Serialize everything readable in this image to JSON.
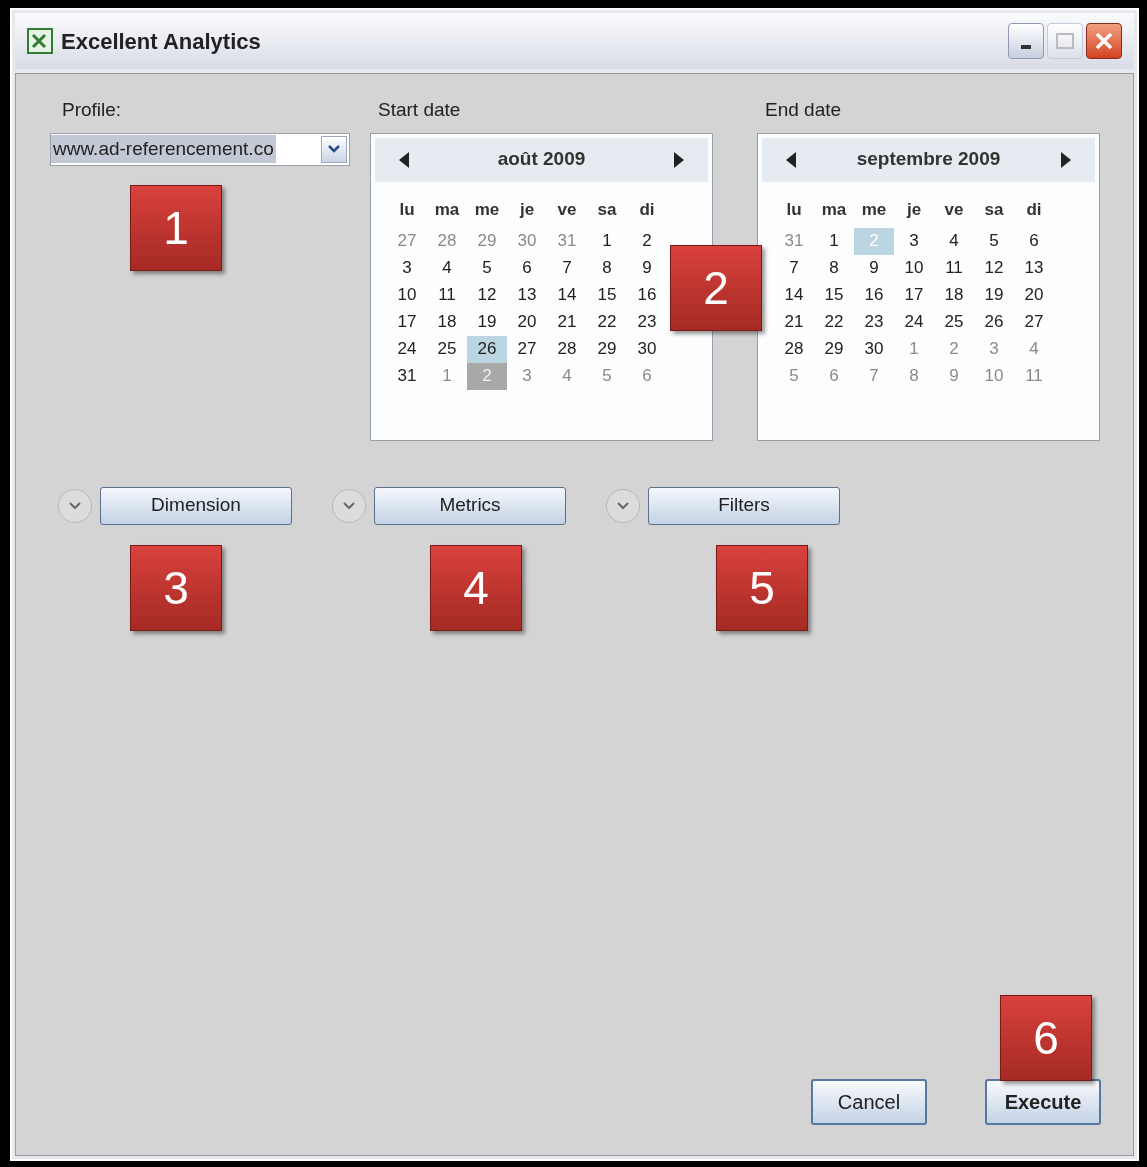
{
  "window": {
    "title": "Excellent Analytics"
  },
  "profile": {
    "label": "Profile:",
    "value": "www.ad-referencement.co"
  },
  "calendars": [
    {
      "label": "Start date",
      "month": "août 2009",
      "weekdays": [
        "lu",
        "ma",
        "me",
        "je",
        "ve",
        "sa",
        "di"
      ],
      "weeks": [
        [
          {
            "day": "27",
            "in_month": false,
            "today": false,
            "selected": false
          },
          {
            "day": "28",
            "in_month": false,
            "today": false,
            "selected": false
          },
          {
            "day": "29",
            "in_month": false,
            "today": false,
            "selected": false
          },
          {
            "day": "30",
            "in_month": false,
            "today": false,
            "selected": false
          },
          {
            "day": "31",
            "in_month": false,
            "today": false,
            "selected": false
          },
          {
            "day": "1",
            "in_month": true,
            "today": false,
            "selected": false
          },
          {
            "day": "2",
            "in_month": true,
            "today": false,
            "selected": false
          }
        ],
        [
          {
            "day": "3",
            "in_month": true,
            "today": false,
            "selected": false
          },
          {
            "day": "4",
            "in_month": true,
            "today": false,
            "selected": false
          },
          {
            "day": "5",
            "in_month": true,
            "today": false,
            "selected": false
          },
          {
            "day": "6",
            "in_month": true,
            "today": false,
            "selected": false
          },
          {
            "day": "7",
            "in_month": true,
            "today": false,
            "selected": false
          },
          {
            "day": "8",
            "in_month": true,
            "today": false,
            "selected": false
          },
          {
            "day": "9",
            "in_month": true,
            "today": false,
            "selected": false
          }
        ],
        [
          {
            "day": "10",
            "in_month": true,
            "today": false,
            "selected": false
          },
          {
            "day": "11",
            "in_month": true,
            "today": false,
            "selected": false
          },
          {
            "day": "12",
            "in_month": true,
            "today": false,
            "selected": false
          },
          {
            "day": "13",
            "in_month": true,
            "today": false,
            "selected": false
          },
          {
            "day": "14",
            "in_month": true,
            "today": false,
            "selected": false
          },
          {
            "day": "15",
            "in_month": true,
            "today": false,
            "selected": false
          },
          {
            "day": "16",
            "in_month": true,
            "today": false,
            "selected": false
          }
        ],
        [
          {
            "day": "17",
            "in_month": true,
            "today": false,
            "selected": false
          },
          {
            "day": "18",
            "in_month": true,
            "today": false,
            "selected": false
          },
          {
            "day": "19",
            "in_month": true,
            "today": false,
            "selected": false
          },
          {
            "day": "20",
            "in_month": true,
            "today": false,
            "selected": false
          },
          {
            "day": "21",
            "in_month": true,
            "today": false,
            "selected": false
          },
          {
            "day": "22",
            "in_month": true,
            "today": false,
            "selected": false
          },
          {
            "day": "23",
            "in_month": true,
            "today": false,
            "selected": false
          }
        ],
        [
          {
            "day": "24",
            "in_month": true,
            "today": false,
            "selected": false
          },
          {
            "day": "25",
            "in_month": true,
            "today": false,
            "selected": false
          },
          {
            "day": "26",
            "in_month": true,
            "today": false,
            "selected": true
          },
          {
            "day": "27",
            "in_month": true,
            "today": false,
            "selected": false
          },
          {
            "day": "28",
            "in_month": true,
            "today": false,
            "selected": false
          },
          {
            "day": "29",
            "in_month": true,
            "today": false,
            "selected": false
          },
          {
            "day": "30",
            "in_month": true,
            "today": false,
            "selected": false
          }
        ],
        [
          {
            "day": "31",
            "in_month": true,
            "today": false,
            "selected": false
          },
          {
            "day": "1",
            "in_month": false,
            "today": false,
            "selected": false
          },
          {
            "day": "2",
            "in_month": false,
            "today": true,
            "selected": false
          },
          {
            "day": "3",
            "in_month": false,
            "today": false,
            "selected": false
          },
          {
            "day": "4",
            "in_month": false,
            "today": false,
            "selected": false
          },
          {
            "day": "5",
            "in_month": false,
            "today": false,
            "selected": false
          },
          {
            "day": "6",
            "in_month": false,
            "today": false,
            "selected": false
          }
        ]
      ]
    },
    {
      "label": "End date",
      "month": "septembre 2009",
      "weekdays": [
        "lu",
        "ma",
        "me",
        "je",
        "ve",
        "sa",
        "di"
      ],
      "weeks": [
        [
          {
            "day": "31",
            "in_month": false,
            "today": false,
            "selected": false
          },
          {
            "day": "1",
            "in_month": true,
            "today": false,
            "selected": false
          },
          {
            "day": "2",
            "in_month": true,
            "today": true,
            "selected": true
          },
          {
            "day": "3",
            "in_month": true,
            "today": false,
            "selected": false
          },
          {
            "day": "4",
            "in_month": true,
            "today": false,
            "selected": false
          },
          {
            "day": "5",
            "in_month": true,
            "today": false,
            "selected": false
          },
          {
            "day": "6",
            "in_month": true,
            "today": false,
            "selected": false
          }
        ],
        [
          {
            "day": "7",
            "in_month": true,
            "today": false,
            "selected": false
          },
          {
            "day": "8",
            "in_month": true,
            "today": false,
            "selected": false
          },
          {
            "day": "9",
            "in_month": true,
            "today": false,
            "selected": false
          },
          {
            "day": "10",
            "in_month": true,
            "today": false,
            "selected": false
          },
          {
            "day": "11",
            "in_month": true,
            "today": false,
            "selected": false
          },
          {
            "day": "12",
            "in_month": true,
            "today": false,
            "selected": false
          },
          {
            "day": "13",
            "in_month": true,
            "today": false,
            "selected": false
          }
        ],
        [
          {
            "day": "14",
            "in_month": true,
            "today": false,
            "selected": false
          },
          {
            "day": "15",
            "in_month": true,
            "today": false,
            "selected": false
          },
          {
            "day": "16",
            "in_month": true,
            "today": false,
            "selected": false
          },
          {
            "day": "17",
            "in_month": true,
            "today": false,
            "selected": false
          },
          {
            "day": "18",
            "in_month": true,
            "today": false,
            "selected": false
          },
          {
            "day": "19",
            "in_month": true,
            "today": false,
            "selected": false
          },
          {
            "day": "20",
            "in_month": true,
            "today": false,
            "selected": false
          }
        ],
        [
          {
            "day": "21",
            "in_month": true,
            "today": false,
            "selected": false
          },
          {
            "day": "22",
            "in_month": true,
            "today": false,
            "selected": false
          },
          {
            "day": "23",
            "in_month": true,
            "today": false,
            "selected": false
          },
          {
            "day": "24",
            "in_month": true,
            "today": false,
            "selected": false
          },
          {
            "day": "25",
            "in_month": true,
            "today": false,
            "selected": false
          },
          {
            "day": "26",
            "in_month": true,
            "today": false,
            "selected": false
          },
          {
            "day": "27",
            "in_month": true,
            "today": false,
            "selected": false
          }
        ],
        [
          {
            "day": "28",
            "in_month": true,
            "today": false,
            "selected": false
          },
          {
            "day": "29",
            "in_month": true,
            "today": false,
            "selected": false
          },
          {
            "day": "30",
            "in_month": true,
            "today": false,
            "selected": false
          },
          {
            "day": "1",
            "in_month": false,
            "today": false,
            "selected": false
          },
          {
            "day": "2",
            "in_month": false,
            "today": false,
            "selected": false
          },
          {
            "day": "3",
            "in_month": false,
            "today": false,
            "selected": false
          },
          {
            "day": "4",
            "in_month": false,
            "today": false,
            "selected": false
          }
        ],
        [
          {
            "day": "5",
            "in_month": false,
            "today": false,
            "selected": false
          },
          {
            "day": "6",
            "in_month": false,
            "today": false,
            "selected": false
          },
          {
            "day": "7",
            "in_month": false,
            "today": false,
            "selected": false
          },
          {
            "day": "8",
            "in_month": false,
            "today": false,
            "selected": false
          },
          {
            "day": "9",
            "in_month": false,
            "today": false,
            "selected": false
          },
          {
            "day": "10",
            "in_month": false,
            "today": false,
            "selected": false
          },
          {
            "day": "11",
            "in_month": false,
            "today": false,
            "selected": false
          }
        ]
      ]
    }
  ],
  "sections": [
    {
      "label": "Dimension",
      "expanded": false
    },
    {
      "label": "Metrics",
      "expanded": false
    },
    {
      "label": "Filters",
      "expanded": false
    }
  ],
  "buttons": [
    {
      "label": "Cancel",
      "kind": "normal"
    },
    {
      "label": "Execute",
      "kind": "default"
    }
  ],
  "callouts": [
    "1",
    "2",
    "3",
    "4",
    "5",
    "6"
  ]
}
